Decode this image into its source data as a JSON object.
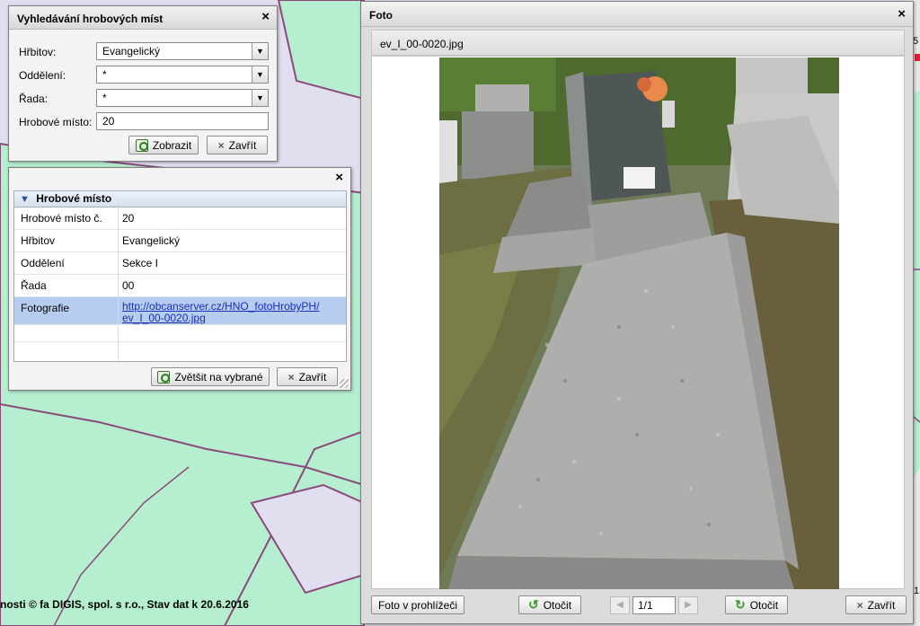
{
  "map": {
    "copyright": "nosti © fa DIGIS, spol. s r.o., Stav dat k 20.6.2016",
    "edge_label_top": "5",
    "edge_label_bottom": "1",
    "colors": {
      "parcel_fill": "#b5efcf",
      "background": "#e0deef",
      "border": "#8c4a7c"
    }
  },
  "search_window": {
    "title": "Vyhledávání hrobových míst",
    "close_icon": "close-icon",
    "fields": {
      "cemetery_label": "Hřbitov:",
      "cemetery_value": "Evangelický",
      "section_label": "Oddělení:",
      "section_value": "*",
      "row_label": "Řada:",
      "row_value": "*",
      "grave_label": "Hrobové místo:",
      "grave_value": "20"
    },
    "show_button": "Zobrazit",
    "close_button": "Zavřít"
  },
  "grave_window": {
    "group_title": "Hrobové místo",
    "rows": [
      {
        "key": "Hrobové místo č.",
        "value": "20"
      },
      {
        "key": "Hřbitov",
        "value": "Evangelický"
      },
      {
        "key": "Oddělení",
        "value": "Sekce I"
      },
      {
        "key": "Řada",
        "value": "00"
      },
      {
        "key": "Fotografie",
        "value_line1": "http://obcanserver.cz/HNO_fotoHrobyPH/",
        "value_line2": "ev_I_00-0020.jpg"
      }
    ],
    "zoom_button": "Zvětšit na vybrané",
    "close_button": "Zavřít"
  },
  "photo_window": {
    "title": "Foto",
    "filename": "ev_I_00-0020.jpg",
    "viewer_button": "Foto v prohlížeči",
    "rotate_left_button": "Otočit",
    "page_value": "1/1",
    "rotate_right_button": "Otočit",
    "close_button": "Zavřít"
  }
}
